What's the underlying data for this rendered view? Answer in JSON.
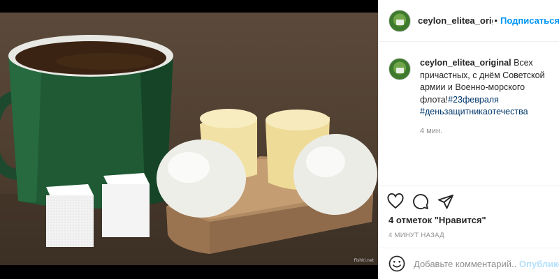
{
  "post": {
    "username": "ceylon_elitea_original",
    "header_username": "ceylon_elitea_origi",
    "dot": "•",
    "follow_label": "Подписаться",
    "caption": {
      "username": "ceylon_elitea_original",
      "text": "Всех причастных, с днём Советской армии и Военно-морского флота!",
      "tag1": "#23февраля",
      "tag2": "#деньзащитникаотечества"
    },
    "comment_time": "4 мин.",
    "likes": "4 отметок \"Нравится\"",
    "post_time": "4 МИНУТ НАЗАД"
  },
  "composer": {
    "placeholder": "Добавьте комментарий...",
    "publish_label": "Опублико"
  },
  "photo": {
    "watermark": "Fishki.net"
  },
  "icons": {
    "like": "heart-icon",
    "comment": "comment-icon",
    "share": "share-icon",
    "emoji": "emoji-icon"
  },
  "colors": {
    "accent": "#0095f6",
    "hashtag": "#00376b",
    "muted": "#8e8e8e",
    "publish_disabled": "#b2dffc"
  }
}
